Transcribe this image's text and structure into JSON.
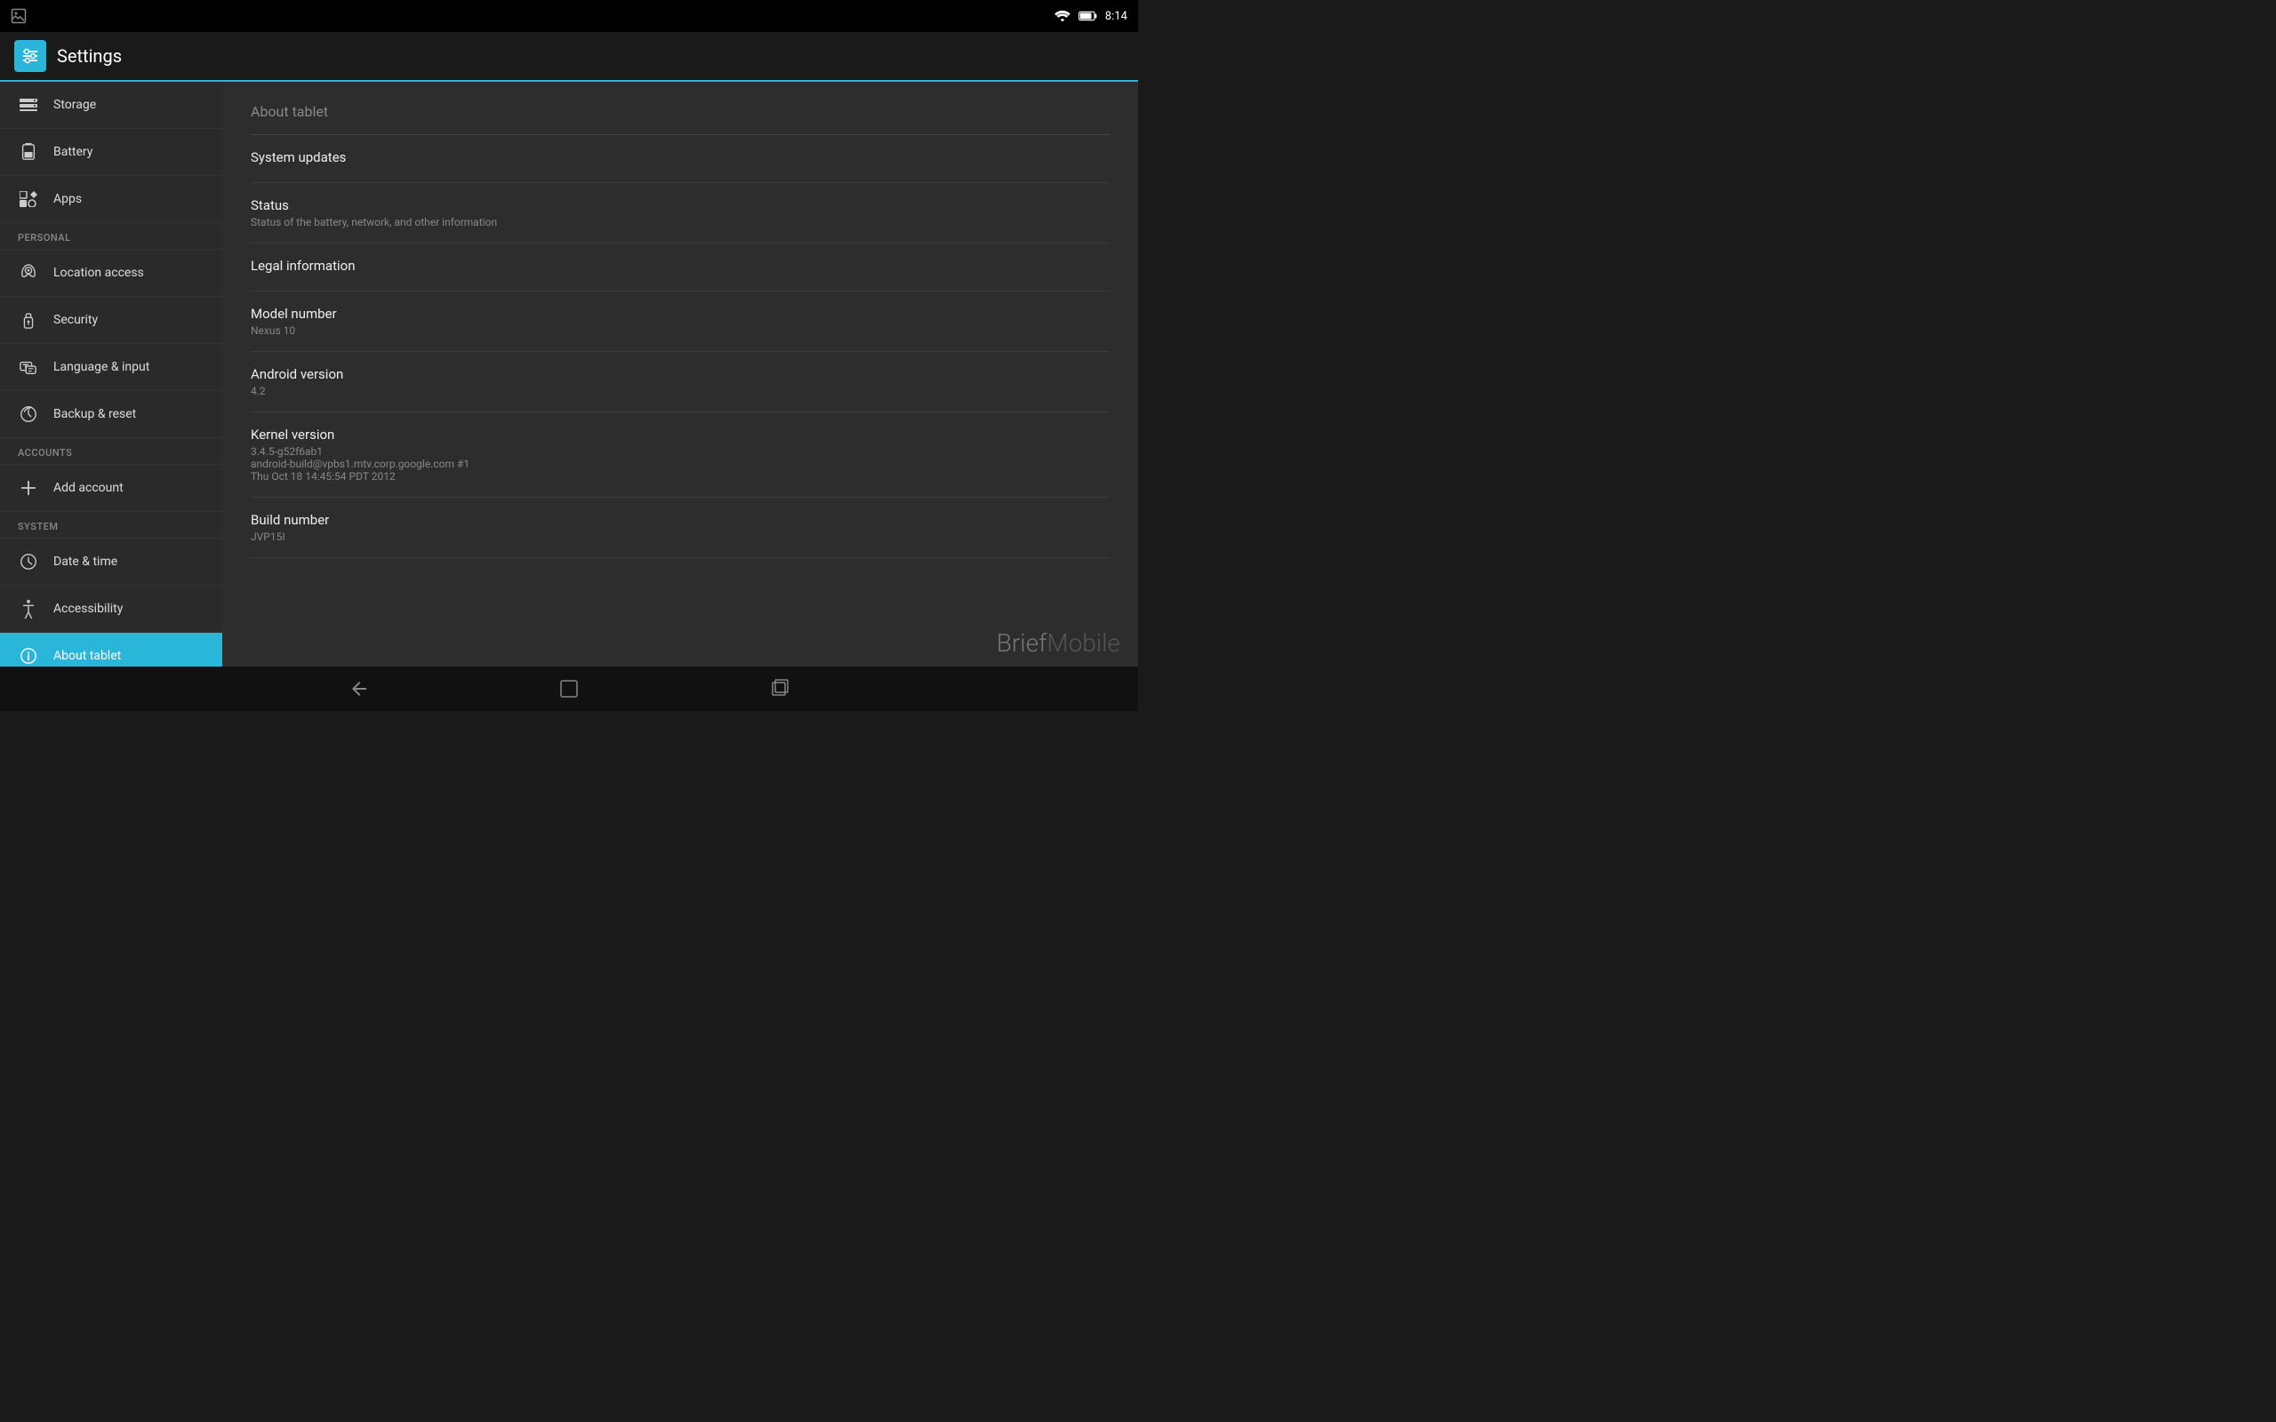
{
  "statusBar": {
    "time": "8:14",
    "wifiAlt": "WiFi connected",
    "batteryAlt": "Battery"
  },
  "topBar": {
    "title": "Settings"
  },
  "sidebar": {
    "items": [
      {
        "id": "storage",
        "label": "Storage",
        "icon": "storage"
      },
      {
        "id": "battery",
        "label": "Battery",
        "icon": "battery"
      },
      {
        "id": "apps",
        "label": "Apps",
        "icon": "apps"
      }
    ],
    "sections": [
      {
        "header": "PERSONAL",
        "items": [
          {
            "id": "location",
            "label": "Location access",
            "icon": "location"
          },
          {
            "id": "security",
            "label": "Security",
            "icon": "security"
          },
          {
            "id": "language",
            "label": "Language & input",
            "icon": "language"
          },
          {
            "id": "backup",
            "label": "Backup & reset",
            "icon": "backup"
          }
        ]
      },
      {
        "header": "ACCOUNTS",
        "items": [
          {
            "id": "addaccount",
            "label": "Add account",
            "icon": "add"
          }
        ]
      },
      {
        "header": "SYSTEM",
        "items": [
          {
            "id": "datetime",
            "label": "Date & time",
            "icon": "clock"
          },
          {
            "id": "accessibility",
            "label": "Accessibility",
            "icon": "accessibility"
          },
          {
            "id": "abouttablet",
            "label": "About tablet",
            "icon": "info",
            "active": true
          }
        ]
      }
    ]
  },
  "content": {
    "title": "About tablet",
    "items": [
      {
        "id": "systemupdates",
        "title": "System updates",
        "subtitle": ""
      },
      {
        "id": "status",
        "title": "Status",
        "subtitle": "Status of the battery, network, and other information"
      },
      {
        "id": "legal",
        "title": "Legal information",
        "subtitle": ""
      },
      {
        "id": "modelnumber",
        "title": "Model number",
        "subtitle": "Nexus 10"
      },
      {
        "id": "androidversion",
        "title": "Android version",
        "subtitle": "4.2"
      },
      {
        "id": "kernelversion",
        "title": "Kernel version",
        "subtitle": "3.4.5-g52f6ab1\nandroid-build@vpbs1.mtv.corp.google.com #1\nThu Oct 18 14:45:54 PDT 2012"
      },
      {
        "id": "buildnumber",
        "title": "Build number",
        "subtitle": "JVP15I"
      }
    ]
  },
  "watermark": {
    "brief": "Brief",
    "mobile": "Mobile"
  },
  "navBar": {
    "back": "←",
    "home": "⌂",
    "recents": "▭"
  }
}
